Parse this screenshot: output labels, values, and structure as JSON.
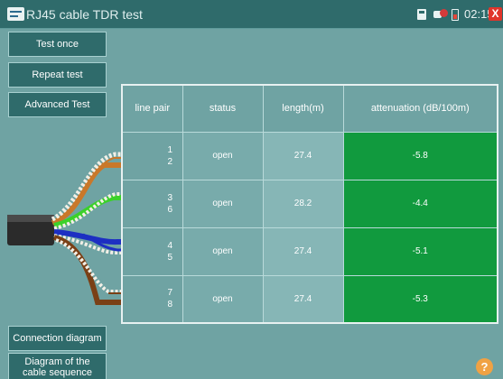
{
  "titlebar": {
    "title": "RJ45 cable TDR test",
    "time": "02:15",
    "icons": [
      "sd-card-icon",
      "network-icon",
      "battery-icon",
      "close-icon"
    ],
    "close_label": "X"
  },
  "sidebar": {
    "test_once": "Test once",
    "repeat_test": "Repeat test",
    "advanced_test": "Advanced Test",
    "connection_diagram": "Connection diagram",
    "cable_sequence": "Diagram of the cable sequence"
  },
  "table": {
    "headers": [
      "line pair",
      "status",
      "length(m)",
      "attenuation (dB/100m)"
    ],
    "rows": [
      {
        "pair_a": "1",
        "pair_b": "2",
        "status": "open",
        "length": "27.4",
        "attenuation": "-5.8"
      },
      {
        "pair_a": "3",
        "pair_b": "6",
        "status": "open",
        "length": "28.2",
        "attenuation": "-4.4"
      },
      {
        "pair_a": "4",
        "pair_b": "5",
        "status": "open",
        "length": "27.4",
        "attenuation": "-5.1"
      },
      {
        "pair_a": "7",
        "pair_b": "8",
        "status": "open",
        "length": "27.4",
        "attenuation": "-5.3"
      }
    ]
  },
  "cable_colors": {
    "orange": "#c9782a",
    "green": "#3bd12a",
    "blue": "#1d2fc2",
    "brown": "#7a4016",
    "accent_green": "#119a3e"
  },
  "help": {
    "label": "?"
  }
}
